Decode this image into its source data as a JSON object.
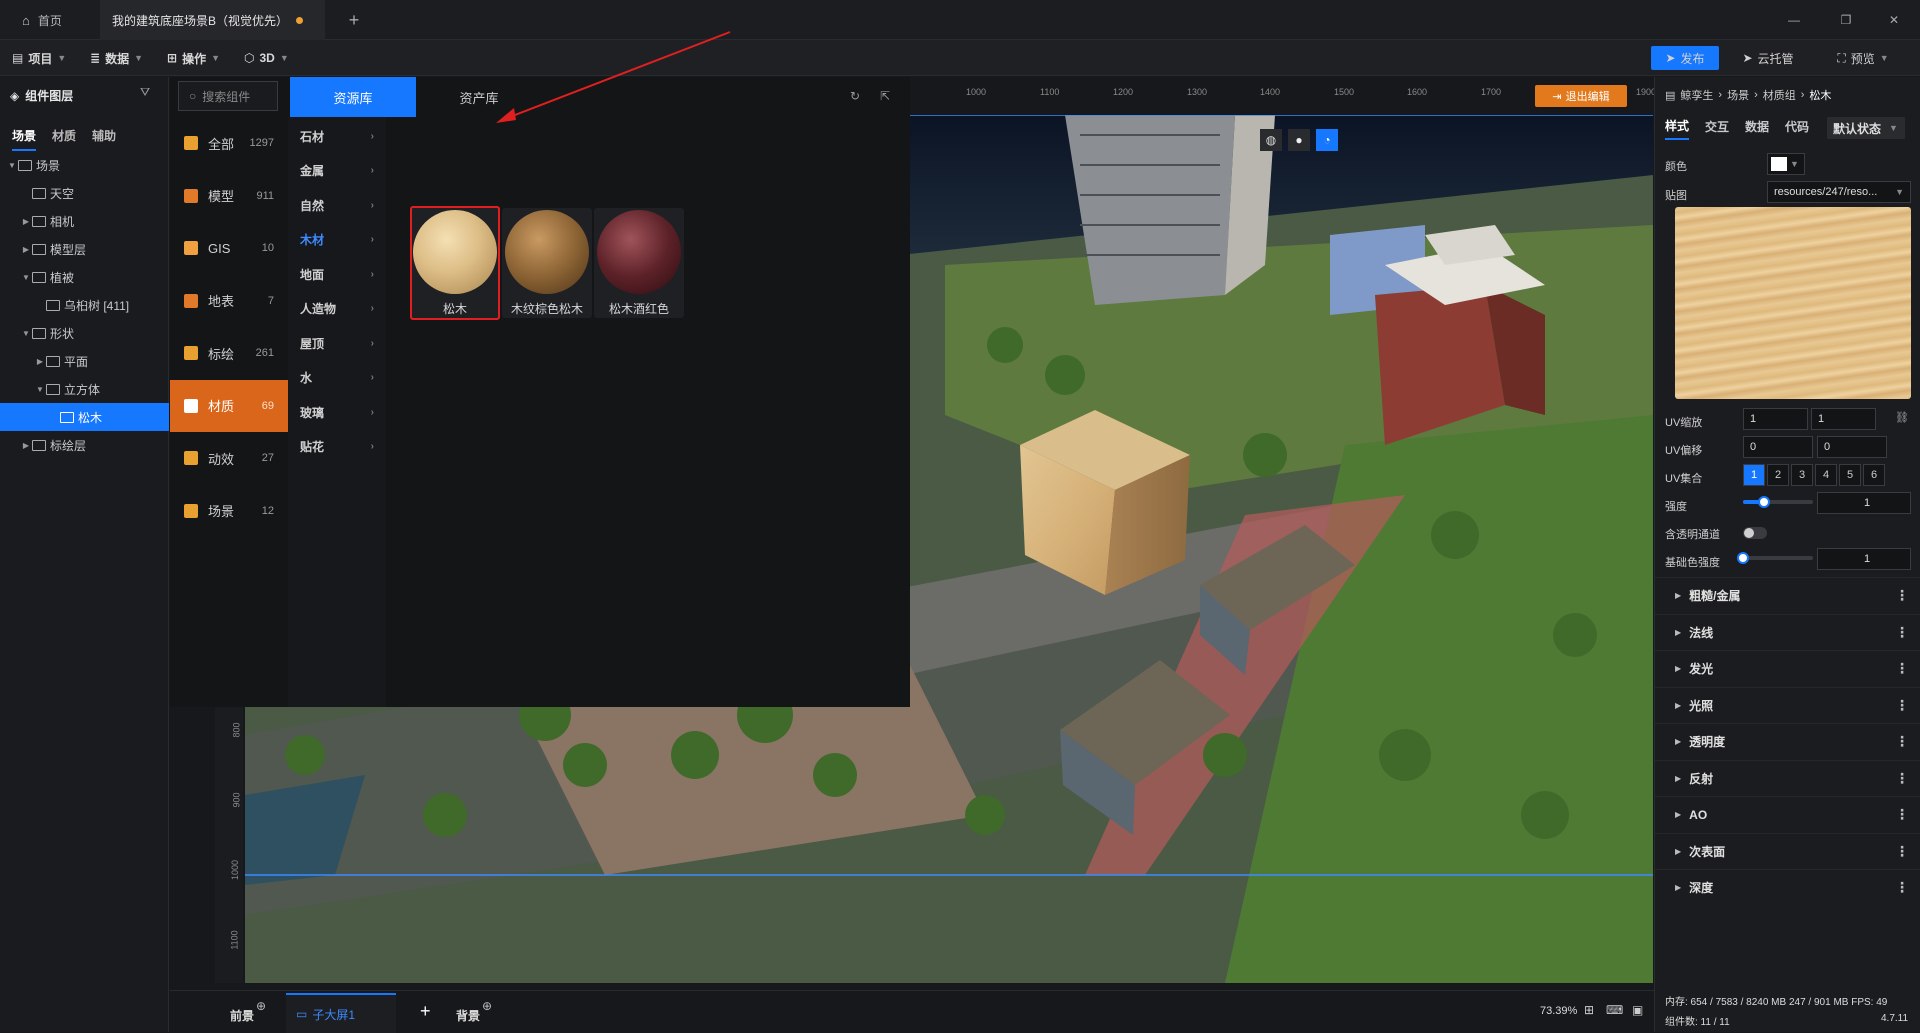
{
  "title_tabs": [
    {
      "label": "首页",
      "icon": "home-icon"
    },
    {
      "label": "我的建筑底座场景B（视觉优先）",
      "icon": "",
      "modified": true
    }
  ],
  "menubar": {
    "items": [
      "项目",
      "数据",
      "操作",
      "3D"
    ],
    "publish": "发布",
    "cloud": "云托管",
    "preview": "预览"
  },
  "layers": {
    "title": "组件图层",
    "tabs": [
      "场景",
      "材质",
      "辅助"
    ],
    "tree": [
      {
        "label": "场景",
        "level": 0,
        "expand": "open",
        "icon": "scene-icon"
      },
      {
        "label": "天空",
        "level": 1,
        "expand": "",
        "icon": "sky-icon"
      },
      {
        "label": "相机",
        "level": 1,
        "expand": "closed",
        "icon": "folder-icon"
      },
      {
        "label": "模型层",
        "level": 1,
        "expand": "closed",
        "icon": "folder-icon"
      },
      {
        "label": "植被",
        "level": 1,
        "expand": "open",
        "icon": "folder-icon"
      },
      {
        "label": "乌桕树 [411]",
        "level": 2,
        "expand": "",
        "icon": "tree-icon"
      },
      {
        "label": "形状",
        "level": 1,
        "expand": "open",
        "icon": "folder-icon"
      },
      {
        "label": "平面",
        "level": 2,
        "expand": "closed",
        "icon": "plane-icon"
      },
      {
        "label": "立方体",
        "level": 2,
        "expand": "open",
        "icon": "cube-icon"
      },
      {
        "label": "松木",
        "level": 3,
        "expand": "",
        "icon": "material-icon",
        "selected": true
      },
      {
        "label": "标绘层",
        "level": 1,
        "expand": "closed",
        "icon": "folder-icon"
      }
    ]
  },
  "resources": {
    "search_placeholder": "搜索组件",
    "tabs": [
      "资源库",
      "资产库"
    ],
    "categories": [
      {
        "label": "全部",
        "count": "1297",
        "color": "#e8a030"
      },
      {
        "label": "模型",
        "count": "911",
        "color": "#e07a2a"
      },
      {
        "label": "GIS",
        "count": "10",
        "color": "#f0a040"
      },
      {
        "label": "地表",
        "count": "7",
        "color": "#e07a2a"
      },
      {
        "label": "标绘",
        "count": "261",
        "color": "#e8a030"
      },
      {
        "label": "材质",
        "count": "69",
        "color": "#ffffff",
        "selected": true
      },
      {
        "label": "动效",
        "count": "27",
        "color": "#e8a030"
      },
      {
        "label": "场景",
        "count": "12",
        "color": "#e8a030"
      }
    ],
    "subcategories": [
      "石材",
      "金属",
      "自然",
      "木材",
      "地面",
      "人造物",
      "屋顶",
      "水",
      "玻璃",
      "贴花"
    ],
    "selected_sub": "木材",
    "materials": [
      {
        "label": "松木",
        "highlight": true
      },
      {
        "label": "木纹棕色松木"
      },
      {
        "label": "松木酒红色"
      }
    ]
  },
  "viewport": {
    "exit_edit": "退出编辑",
    "ruler_top": [
      "1000",
      "1100",
      "1200",
      "1300",
      "1400",
      "1500",
      "1600",
      "1700",
      "1900"
    ],
    "ruler_left": [
      "800",
      "900",
      "1000",
      "1100"
    ]
  },
  "right": {
    "breadcrumb": [
      "鲸孪生",
      "场景",
      "材质组",
      "松木"
    ],
    "tabs": [
      "样式",
      "交互",
      "数据",
      "代码"
    ],
    "state": "默认状态",
    "color_label": "颜色",
    "texture_label": "贴图",
    "texture_value": "resources/247/reso...",
    "uv_scale_label": "UV缩放",
    "uv_scale": [
      "1",
      "1"
    ],
    "uv_offset_label": "UV偏移",
    "uv_offset": [
      "0",
      "0"
    ],
    "uv_set_label": "UV集合",
    "uv_set": [
      "1",
      "2",
      "3",
      "4",
      "5",
      "6"
    ],
    "strength_label": "强度",
    "strength": "1",
    "strength_level": 0.3,
    "alpha_label": "含透明通道",
    "base_strength_label": "基础色强度",
    "base_strength": "1",
    "base_strength_level": 0.0,
    "sections": [
      "粗糙/金属",
      "法线",
      "发光",
      "光照",
      "透明度",
      "反射",
      "AO",
      "次表面",
      "深度"
    ],
    "memory": "内存:  654 / 7583 / 8240 MB  247 / 901 MB  FPS:  49",
    "components": "组件数: 11 / 11",
    "version": "4.7.11"
  },
  "bottom": {
    "front": "前景",
    "screen": "子大屏1",
    "back": "背景",
    "zoom": "73.39%"
  }
}
